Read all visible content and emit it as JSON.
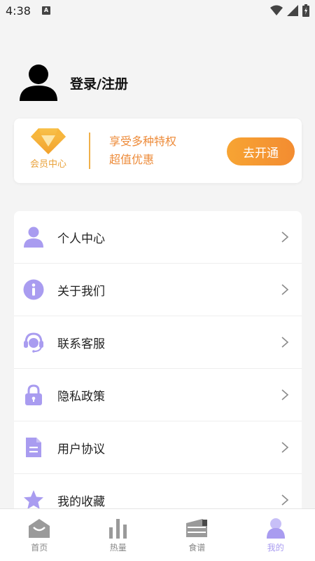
{
  "status_bar": {
    "time": "4:38",
    "badge": "A",
    "icons": [
      "wifi-icon",
      "signal-icon",
      "battery-icon"
    ]
  },
  "profile": {
    "login_label": "登录/注册",
    "icon": "avatar-icon"
  },
  "vip": {
    "label": "会员中心",
    "perks": [
      "享受多种特权",
      "超值优惠"
    ],
    "button": "去开通",
    "accent": "#f39b33"
  },
  "menu": [
    {
      "label": "个人中心",
      "icon": "person-icon"
    },
    {
      "label": "关于我们",
      "icon": "info-icon"
    },
    {
      "label": "联系客服",
      "icon": "headset-icon"
    },
    {
      "label": "隐私政策",
      "icon": "lock-icon"
    },
    {
      "label": "用户协议",
      "icon": "document-icon"
    },
    {
      "label": "我的收藏",
      "icon": "star-icon"
    }
  ],
  "nav": [
    {
      "label": "首页",
      "icon": "home-icon",
      "active": false
    },
    {
      "label": "热量",
      "icon": "bar-chart-icon",
      "active": false
    },
    {
      "label": "食谱",
      "icon": "recipe-icon",
      "active": false
    },
    {
      "label": "我的",
      "icon": "profile-icon",
      "active": true
    }
  ],
  "colors": {
    "icon_purple": "#a99cf0",
    "nav_inactive": "#888888",
    "nav_active": "#a99cf0"
  }
}
